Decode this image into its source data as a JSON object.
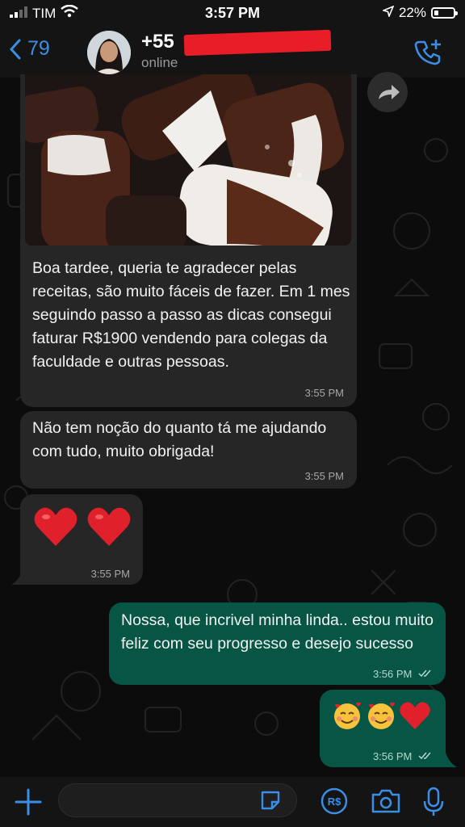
{
  "status_bar": {
    "carrier": "TIM",
    "time": "3:57 PM",
    "battery": "22%"
  },
  "header": {
    "back_count": "79",
    "contact_name": "+55",
    "contact_status": "online"
  },
  "messages": [
    {
      "direction": "incoming",
      "has_image": true,
      "text": "Boa tardee, queria te agradecer pelas receitas, são muito fáceis de fazer. Em 1 mes seguindo passo a passo as dicas consegui faturar R$1900 vendendo para colegas da faculdade e outras pessoas.",
      "time": "3:55 PM"
    },
    {
      "direction": "incoming",
      "text": "Não tem noção do quanto tá me ajudando com tudo, muito obrigada!",
      "time": "3:55 PM"
    },
    {
      "direction": "incoming",
      "text": "❤️ ❤️",
      "time": "3:55 PM"
    },
    {
      "direction": "outgoing",
      "text": "Nossa, que incrivel minha linda.. estou muito feliz com seu progresso e desejo sucesso",
      "time": "3:56 PM",
      "status": "read"
    },
    {
      "direction": "outgoing",
      "text": "🥰🥰❤️",
      "time": "3:56 PM",
      "status": "read"
    }
  ],
  "colors": {
    "accent": "#3b8ee6",
    "incoming_bubble": "#262626",
    "outgoing_bubble": "#065545"
  },
  "icons": [
    "wifi-icon",
    "location-icon",
    "battery-icon",
    "back-chevron-icon",
    "call-add-icon",
    "share-icon",
    "plus-icon",
    "sticker-icon",
    "payment-icon",
    "camera-icon",
    "microphone-icon"
  ]
}
